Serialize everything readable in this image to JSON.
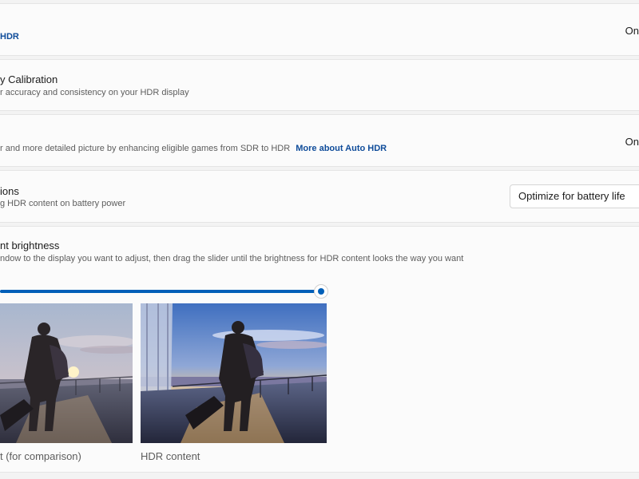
{
  "hdr": {
    "link_label": "HDR",
    "state": "On"
  },
  "calibration": {
    "title": "y Calibration",
    "description": "r accuracy and consistency on your HDR display"
  },
  "auto_hdr": {
    "description": "r and more detailed picture by enhancing eligible games from SDR to HDR",
    "link_label": "More about Auto HDR",
    "state": "On"
  },
  "battery": {
    "title": "ions",
    "description": "g HDR content on battery power",
    "select_value": "Optimize for battery life"
  },
  "brightness": {
    "title": "nt brightness",
    "description": "ndow to the display you want to adjust, then drag the slider until the brightness for HDR content looks the way you want",
    "slider_fraction": 0.98,
    "sdr_caption": "t (for comparison)",
    "hdr_caption": "HDR content"
  },
  "colors": {
    "accent": "#005fb8",
    "link": "#0f4c9a"
  }
}
